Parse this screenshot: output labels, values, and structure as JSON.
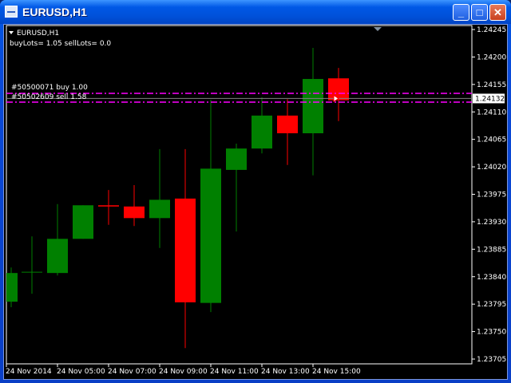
{
  "window": {
    "title": "EURUSD,H1",
    "buttons": [
      "minimize",
      "maximize",
      "close"
    ]
  },
  "chart_data": {
    "type": "candlestick",
    "symbol_label": "EURUSD,H1",
    "info_text": "buyLots= 1.05  sellLots= 0.0",
    "x_tick_labels": [
      "24 Nov 2014",
      "24 Nov 05:00",
      "24 Nov 07:00",
      "24 Nov 09:00",
      "24 Nov 11:00",
      "24 Nov 13:00",
      "24 Nov 15:00"
    ],
    "y_tick_labels": [
      "1.24245",
      "1.24200",
      "1.24155",
      "1.24110",
      "1.24065",
      "1.24020",
      "1.23975",
      "1.23930",
      "1.23885",
      "1.23840",
      "1.23795",
      "1.23750",
      "1.23705"
    ],
    "ylim": [
      1.23705,
      1.24245
    ],
    "current_price": "1.24132",
    "candles": [
      {
        "time": "03:00",
        "o": 1.23799,
        "h": 1.23855,
        "l": 1.2379,
        "c": 1.23846
      },
      {
        "time": "04:00",
        "o": 1.23848,
        "h": 1.23906,
        "l": 1.23812,
        "c": 1.23848
      },
      {
        "time": "05:00",
        "o": 1.23846,
        "h": 1.23959,
        "l": 1.23842,
        "c": 1.23902
      },
      {
        "time": "06:00",
        "o": 1.23902,
        "h": 1.23957,
        "l": 1.23902,
        "c": 1.23957
      },
      {
        "time": "07:00",
        "o": 1.23957,
        "h": 1.23982,
        "l": 1.23925,
        "c": 1.23955
      },
      {
        "time": "08:00",
        "o": 1.23955,
        "h": 1.2399,
        "l": 1.23923,
        "c": 1.23936
      },
      {
        "time": "09:00",
        "o": 1.23936,
        "h": 1.24049,
        "l": 1.23887,
        "c": 1.23966
      },
      {
        "time": "10:00",
        "o": 1.23968,
        "h": 1.24049,
        "l": 1.23723,
        "c": 1.23798
      },
      {
        "time": "11:00",
        "o": 1.23797,
        "h": 1.2413,
        "l": 1.23782,
        "c": 1.24017
      },
      {
        "time": "12:00",
        "o": 1.24015,
        "h": 1.24058,
        "l": 1.23914,
        "c": 1.2405
      },
      {
        "time": "13:00",
        "o": 1.2405,
        "h": 1.24134,
        "l": 1.24042,
        "c": 1.24104
      },
      {
        "time": "14:00",
        "o": 1.24104,
        "h": 1.24131,
        "l": 1.24023,
        "c": 1.24075
      },
      {
        "time": "15:00",
        "o": 1.24075,
        "h": 1.24215,
        "l": 1.24006,
        "c": 1.24164
      },
      {
        "time": "16:00",
        "o": 1.24165,
        "h": 1.24182,
        "l": 1.24095,
        "c": 1.24129
      }
    ],
    "orders": [
      {
        "label": "#50500071 buy 1.00",
        "price": 1.2414
      },
      {
        "label": "#50502609 sell 1.58",
        "price": 1.24126
      }
    ],
    "colors": {
      "bull": "#008000",
      "bear": "#ff0000",
      "background": "#000000",
      "order_line": "#ff00ff",
      "bid_line": "#808080"
    }
  }
}
